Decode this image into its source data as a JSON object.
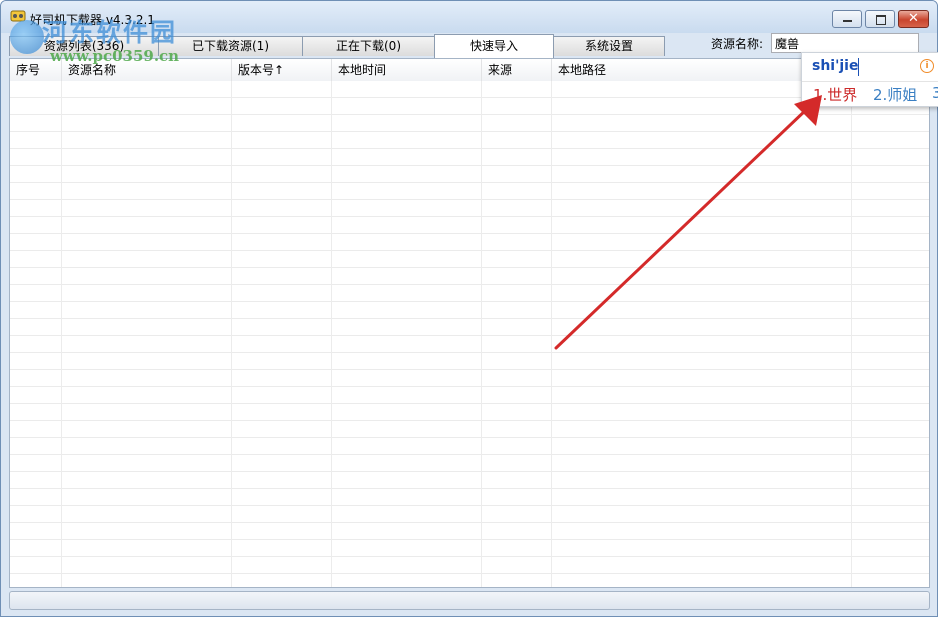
{
  "window": {
    "title": "好司机下载器 v4.3.2.1",
    "minimize_symbol": "–",
    "maximize_symbol": "□",
    "close_symbol": "✕"
  },
  "watermark": {
    "title": "河东软件园",
    "url": "www.pc0359.cn"
  },
  "tabs": [
    {
      "label": "资源列表(336)",
      "active": false
    },
    {
      "label": "已下载资源(1)",
      "active": false
    },
    {
      "label": "正在下载(0)",
      "active": false
    },
    {
      "label": "快速导入",
      "active": true
    },
    {
      "label": "系统设置",
      "active": false
    }
  ],
  "search": {
    "label": "资源名称:",
    "value": "魔兽"
  },
  "table": {
    "columns": [
      "序号",
      "资源名称",
      "版本号↑",
      "本地时间",
      "来源",
      "本地路径"
    ],
    "rows": []
  },
  "ime": {
    "composition": "shi'jie",
    "info_symbol": "i",
    "candidates": [
      "1.世界",
      "2.师姐",
      "3"
    ]
  },
  "colors": {
    "annotation_arrow": "#d42a2a",
    "ime_selected": "#cc2a2a",
    "ime_other": "#3a7fc3"
  }
}
